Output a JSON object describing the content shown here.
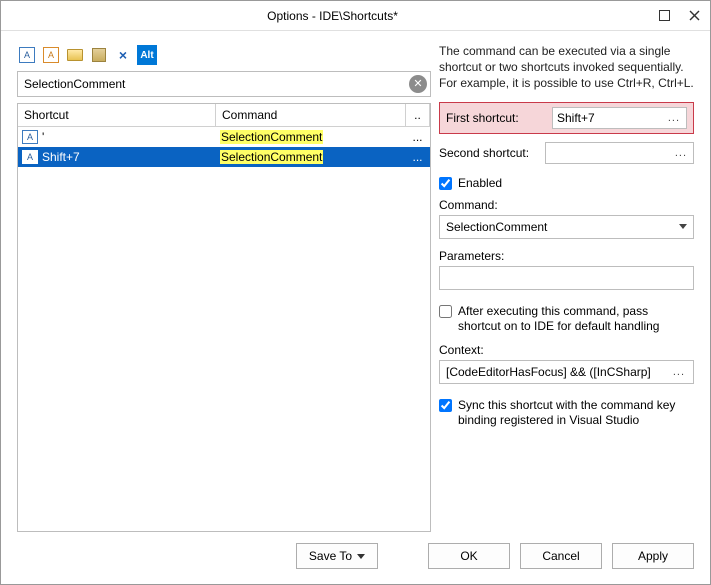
{
  "title": "Options - IDE\\Shortcuts*",
  "toolbar": {
    "alt_label": "Alt"
  },
  "search": {
    "value": "SelectionComment"
  },
  "grid": {
    "headers": {
      "shortcut": "Shortcut",
      "command": "Command",
      "dots": ".."
    },
    "rows": [
      {
        "shortcut": "'",
        "command": "SelectionComment",
        "selected": false,
        "dots": "..."
      },
      {
        "shortcut": "Shift+7",
        "command": "SelectionComment",
        "selected": true,
        "dots": "..."
      }
    ]
  },
  "right": {
    "description": "The command can be executed via a single shortcut or two shortcuts invoked sequentially. For example, it is possible to use Ctrl+R, Ctrl+L.",
    "first_label": "First shortcut:",
    "first_value": "Shift+7",
    "second_label": "Second shortcut:",
    "second_value": "",
    "enabled_label": "Enabled",
    "command_label": "Command:",
    "command_value": "SelectionComment",
    "parameters_label": "Parameters:",
    "parameters_value": "",
    "pass_label": "After executing this command, pass shortcut on to IDE for default handling",
    "context_label": "Context:",
    "context_value": "[CodeEditorHasFocus] && ([InCSharp]",
    "context_ellipsis": "...",
    "sync_label": "Sync this shortcut with the command key binding registered in Visual Studio"
  },
  "footer": {
    "saveto": "Save To",
    "ok": "OK",
    "cancel": "Cancel",
    "apply": "Apply"
  }
}
